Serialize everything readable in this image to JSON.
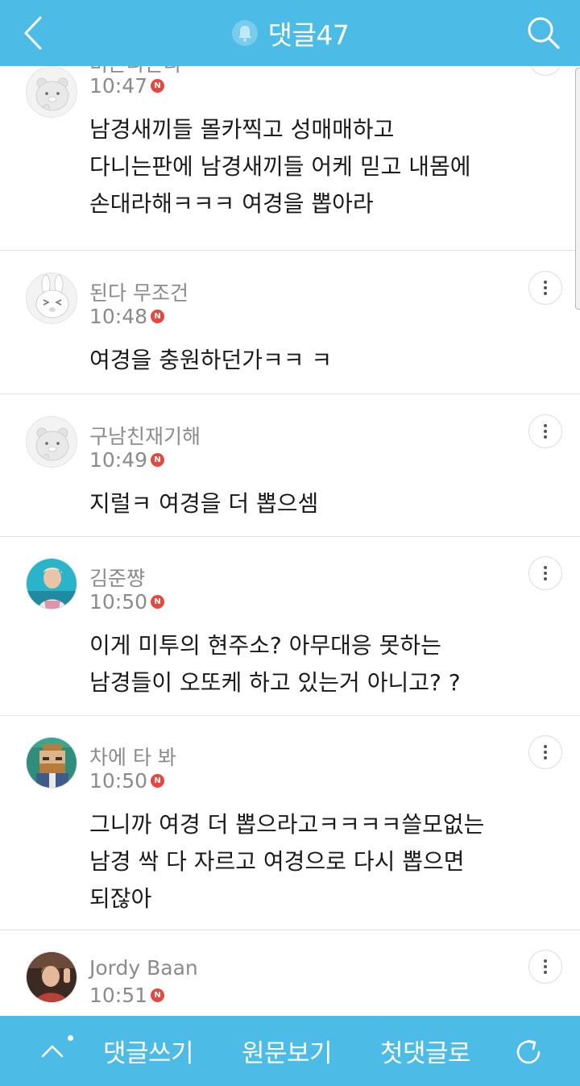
{
  "header": {
    "title": "댓글47",
    "back_icon": "back-chevron-icon",
    "bell_icon": "bell-icon",
    "search_icon": "search-icon"
  },
  "colors": {
    "bar": "#4cbbe6",
    "badge": "#e8473f",
    "meta_text": "#8b8b8b",
    "body_text": "#1a1a1a"
  },
  "comments": [
    {
      "author": "비존나온다",
      "time": "10:47",
      "badge": "N",
      "avatar": "ryan-character-avatar",
      "lines": [
        "남경새끼들 몰카찍고 성매매하고",
        "다니는판에 남경새끼들 어케 믿고 내몸에",
        "손대라해ㅋㅋㅋ 여경을 뽑아라"
      ]
    },
    {
      "author": "된다 무조건",
      "time": "10:48",
      "badge": "N",
      "avatar": "muzi-character-avatar",
      "lines": [
        "여경을 충원하던가ㅋㅋ ㅋ"
      ]
    },
    {
      "author": "구남친재기해",
      "time": "10:49",
      "badge": "N",
      "avatar": "ryan-character-avatar",
      "lines": [
        "지럴ㅋ 여경을 더 뽑으셈"
      ]
    },
    {
      "author": "김준쨩",
      "time": "10:50",
      "badge": "N",
      "avatar": "photo-avatar",
      "lines": [
        "이게 미투의 현주소? 아무대응 못하는",
        "남경들이 오또케 하고 있는거 아니고? ?"
      ]
    },
    {
      "author": "차에 타 봐",
      "time": "10:50",
      "badge": "N",
      "avatar": "pixel-art-avatar",
      "lines": [
        "그니까 여경 더 뽑으라고ㅋㅋㅋㅋ쓸모없는",
        "남경 싹 다 자르고 여경으로 다시 뽑으면",
        "되잖아"
      ]
    },
    {
      "author": "Jordy Baan",
      "time": "10:51",
      "badge": "N",
      "avatar": "photo-avatar",
      "lines": []
    }
  ],
  "footer": {
    "write_label": "댓글쓰기",
    "original_label": "원문보기",
    "first_label": "첫댓글로",
    "up_icon": "chevron-up-icon",
    "refresh_icon": "refresh-icon"
  }
}
